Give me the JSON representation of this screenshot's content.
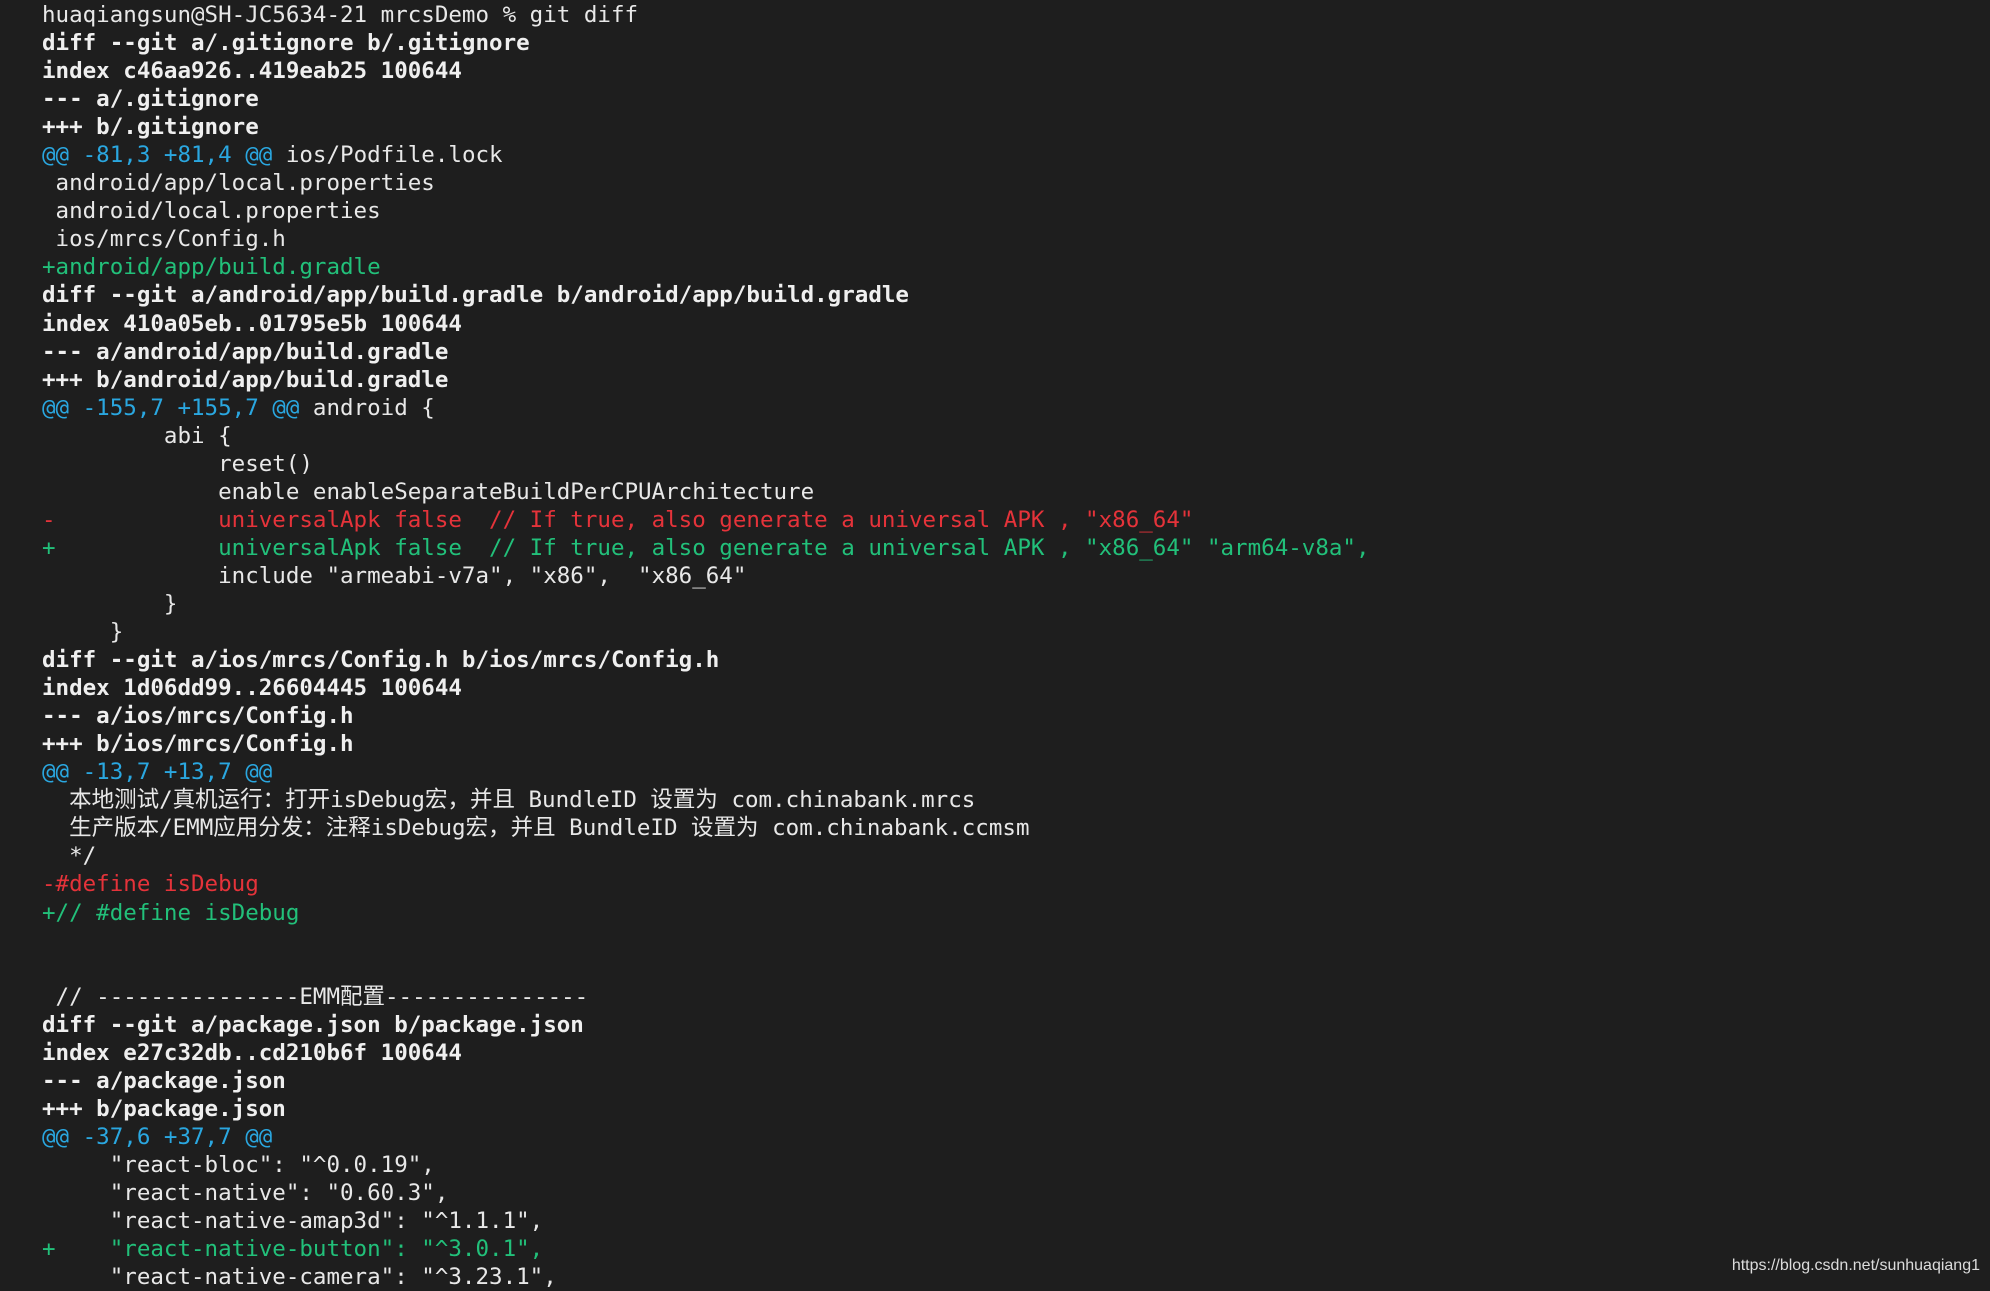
{
  "terminal": {
    "colors": {
      "background": "#1e1e1e",
      "text": "#e8e8e8",
      "meta": "#efefef",
      "hunk": "#2aa7e0",
      "added": "#22c07a",
      "removed": "#e5333a"
    },
    "lines": [
      {
        "type": "prompt",
        "text": "huaqiangsun@SH-JC5634-21 mrcsDemo % git diff"
      },
      {
        "type": "meta",
        "text": "diff --git a/.gitignore b/.gitignore"
      },
      {
        "type": "meta",
        "text": "index c46aa926..419eab25 100644"
      },
      {
        "type": "meta",
        "text": "--- a/.gitignore"
      },
      {
        "type": "meta",
        "text": "+++ b/.gitignore"
      },
      {
        "type": "hunk",
        "text": "@@ -81,3 +81,4 @@",
        "suffix": " ios/Podfile.lock"
      },
      {
        "type": "ctx",
        "text": " android/app/local.properties"
      },
      {
        "type": "ctx",
        "text": " android/local.properties"
      },
      {
        "type": "ctx",
        "text": " ios/mrcs/Config.h"
      },
      {
        "type": "add",
        "text": "+android/app/build.gradle"
      },
      {
        "type": "meta",
        "text": "diff --git a/android/app/build.gradle b/android/app/build.gradle"
      },
      {
        "type": "meta",
        "text": "index 410a05eb..01795e5b 100644"
      },
      {
        "type": "meta",
        "text": "--- a/android/app/build.gradle"
      },
      {
        "type": "meta",
        "text": "+++ b/android/app/build.gradle"
      },
      {
        "type": "hunk",
        "text": "@@ -155,7 +155,7 @@",
        "suffix": " android {"
      },
      {
        "type": "ctx",
        "text": "         abi {"
      },
      {
        "type": "ctx",
        "text": "             reset()"
      },
      {
        "type": "ctx",
        "text": "             enable enableSeparateBuildPerCPUArchitecture"
      },
      {
        "type": "del",
        "text": "-            universalApk false  // If true, also generate a universal APK , \"x86_64\""
      },
      {
        "type": "add",
        "text": "+            universalApk false  // If true, also generate a universal APK , \"x86_64\" \"arm64-v8a\","
      },
      {
        "type": "ctx",
        "text": "             include \"armeabi-v7a\", \"x86\",  \"x86_64\""
      },
      {
        "type": "ctx",
        "text": "         }"
      },
      {
        "type": "ctx",
        "text": "     }"
      },
      {
        "type": "meta",
        "text": "diff --git a/ios/mrcs/Config.h b/ios/mrcs/Config.h"
      },
      {
        "type": "meta",
        "text": "index 1d06dd99..26604445 100644"
      },
      {
        "type": "meta",
        "text": "--- a/ios/mrcs/Config.h"
      },
      {
        "type": "meta",
        "text": "+++ b/ios/mrcs/Config.h"
      },
      {
        "type": "hunk",
        "text": "@@ -13,7 +13,7 @@",
        "suffix": ""
      },
      {
        "type": "ctx",
        "text": "  本地测试/真机运行：打开isDebug宏，并且 BundleID 设置为 com.chinabank.mrcs"
      },
      {
        "type": "ctx",
        "text": "  生产版本/EMM应用分发：注释isDebug宏，并且 BundleID 设置为 com.chinabank.ccmsm"
      },
      {
        "type": "ctx",
        "text": "  */"
      },
      {
        "type": "del",
        "text": "-#define isDebug"
      },
      {
        "type": "add",
        "text": "+// #define isDebug"
      },
      {
        "type": "blank",
        "text": " "
      },
      {
        "type": "blank",
        "text": " "
      },
      {
        "type": "ctx",
        "text": " // ---------------EMM配置---------------"
      },
      {
        "type": "meta",
        "text": "diff --git a/package.json b/package.json"
      },
      {
        "type": "meta",
        "text": "index e27c32db..cd210b6f 100644"
      },
      {
        "type": "meta",
        "text": "--- a/package.json"
      },
      {
        "type": "meta",
        "text": "+++ b/package.json"
      },
      {
        "type": "hunk",
        "text": "@@ -37,6 +37,7 @@",
        "suffix": ""
      },
      {
        "type": "ctx",
        "text": "     \"react-bloc\": \"^0.0.19\","
      },
      {
        "type": "ctx",
        "text": "     \"react-native\": \"0.60.3\","
      },
      {
        "type": "ctx",
        "text": "     \"react-native-amap3d\": \"^1.1.1\","
      },
      {
        "type": "add",
        "text": "+    \"react-native-button\": \"^3.0.1\","
      },
      {
        "type": "ctx",
        "text": "     \"react-native-camera\": \"^3.23.1\","
      }
    ]
  },
  "watermark": {
    "text": "https://blog.csdn.net/sunhuaqiang1"
  }
}
